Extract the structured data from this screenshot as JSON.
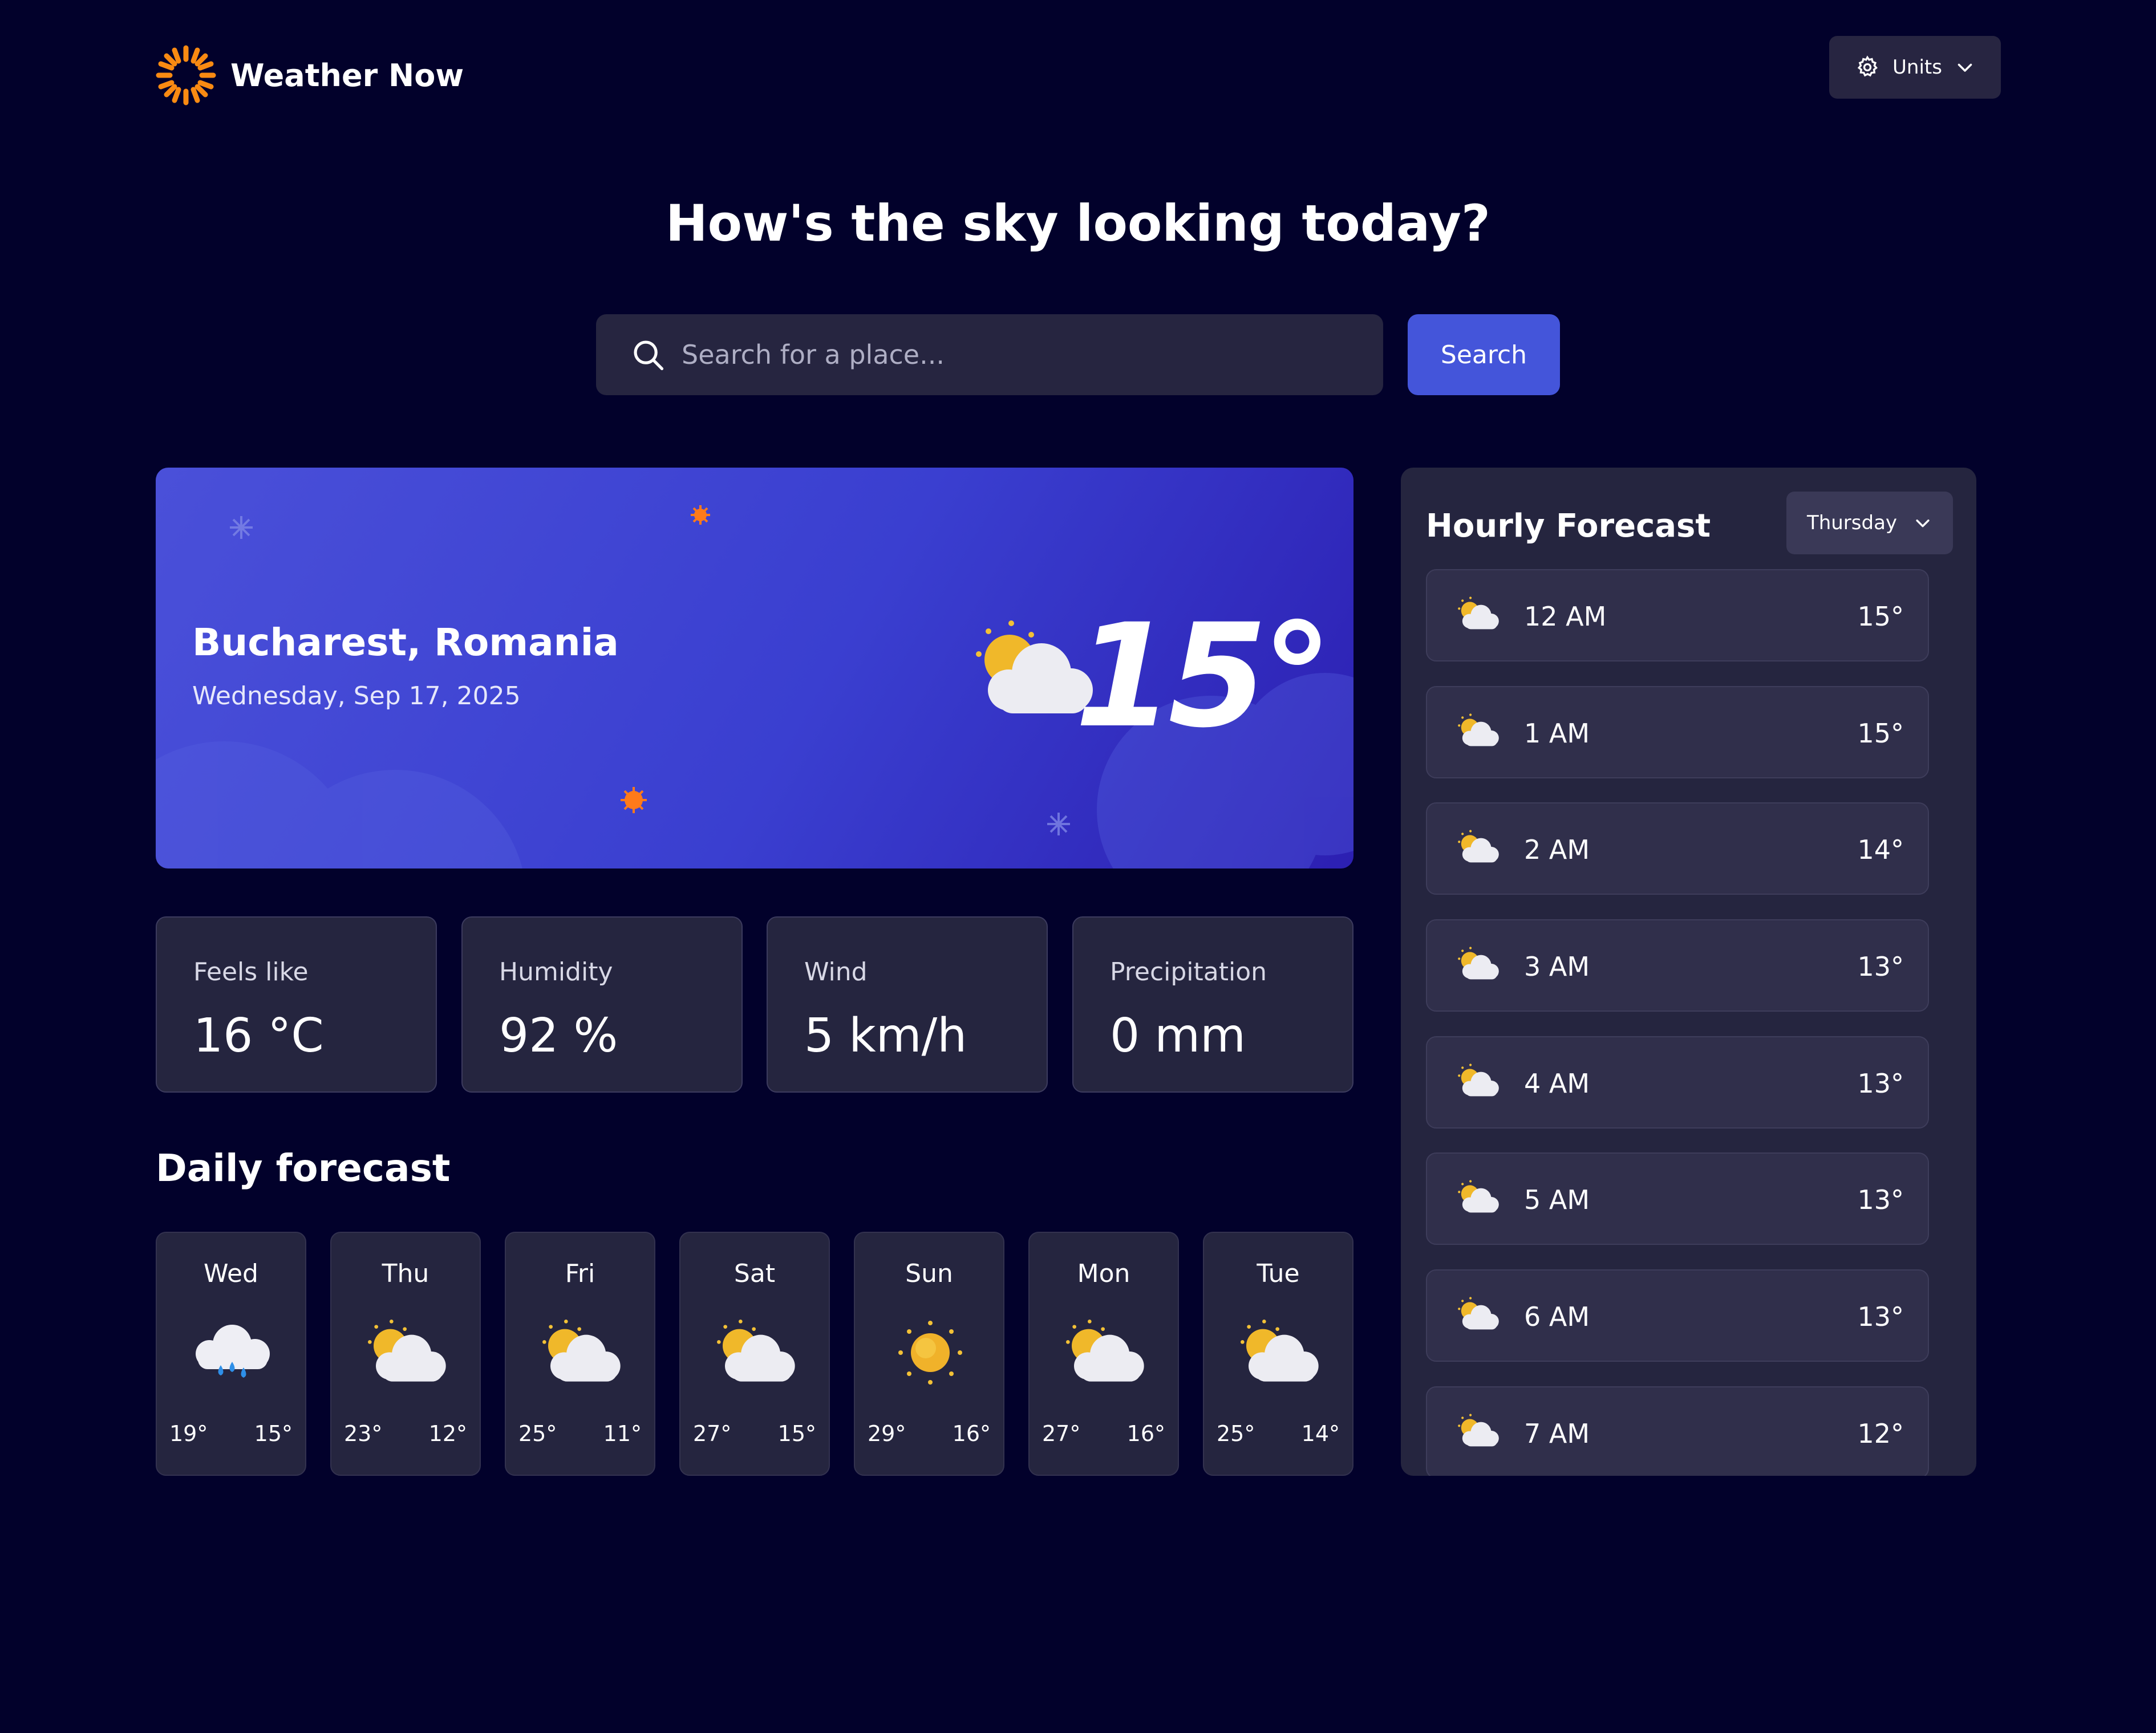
{
  "header": {
    "app_name": "Weather Now",
    "units_label": "Units"
  },
  "hero": {
    "title": "How's the sky looking today?",
    "search_placeholder": "Search for a place...",
    "search_button": "Search"
  },
  "current": {
    "location": "Bucharest, Romania",
    "date": "Wednesday, Sep 17, 2025",
    "temperature": "15°",
    "icon": "partly-cloudy-icon"
  },
  "metrics": [
    {
      "label": "Feels like",
      "value": "16 °C"
    },
    {
      "label": "Humidity",
      "value": "92 %"
    },
    {
      "label": "Wind",
      "value": "5 km/h"
    },
    {
      "label": "Precipitation",
      "value": "0 mm"
    }
  ],
  "daily": {
    "title": "Daily forecast",
    "days": [
      {
        "day": "Wed",
        "icon": "rain-icon",
        "high": "19°",
        "low": "15°"
      },
      {
        "day": "Thu",
        "icon": "partly-cloudy-icon",
        "high": "23°",
        "low": "12°"
      },
      {
        "day": "Fri",
        "icon": "partly-cloudy-icon",
        "high": "25°",
        "low": "11°"
      },
      {
        "day": "Sat",
        "icon": "partly-cloudy-icon",
        "high": "27°",
        "low": "15°"
      },
      {
        "day": "Sun",
        "icon": "sun-icon",
        "high": "29°",
        "low": "16°"
      },
      {
        "day": "Mon",
        "icon": "partly-cloudy-icon",
        "high": "27°",
        "low": "16°"
      },
      {
        "day": "Tue",
        "icon": "partly-cloudy-icon",
        "high": "25°",
        "low": "14°"
      }
    ]
  },
  "hourly": {
    "title": "Hourly Forecast",
    "selected_day": "Thursday",
    "hours": [
      {
        "time": "12 AM",
        "temp": "15°",
        "icon": "partly-cloudy-icon"
      },
      {
        "time": "1 AM",
        "temp": "15°",
        "icon": "partly-cloudy-icon"
      },
      {
        "time": "2 AM",
        "temp": "14°",
        "icon": "partly-cloudy-icon"
      },
      {
        "time": "3 AM",
        "temp": "13°",
        "icon": "partly-cloudy-icon"
      },
      {
        "time": "4 AM",
        "temp": "13°",
        "icon": "partly-cloudy-icon"
      },
      {
        "time": "5 AM",
        "temp": "13°",
        "icon": "partly-cloudy-icon"
      },
      {
        "time": "6 AM",
        "temp": "13°",
        "icon": "partly-cloudy-icon"
      },
      {
        "time": "7 AM",
        "temp": "12°",
        "icon": "partly-cloudy-icon"
      }
    ]
  },
  "colors": {
    "background": "#02012b",
    "card": "#25253f",
    "accent": "#4455da",
    "logo": "#f98a12"
  }
}
